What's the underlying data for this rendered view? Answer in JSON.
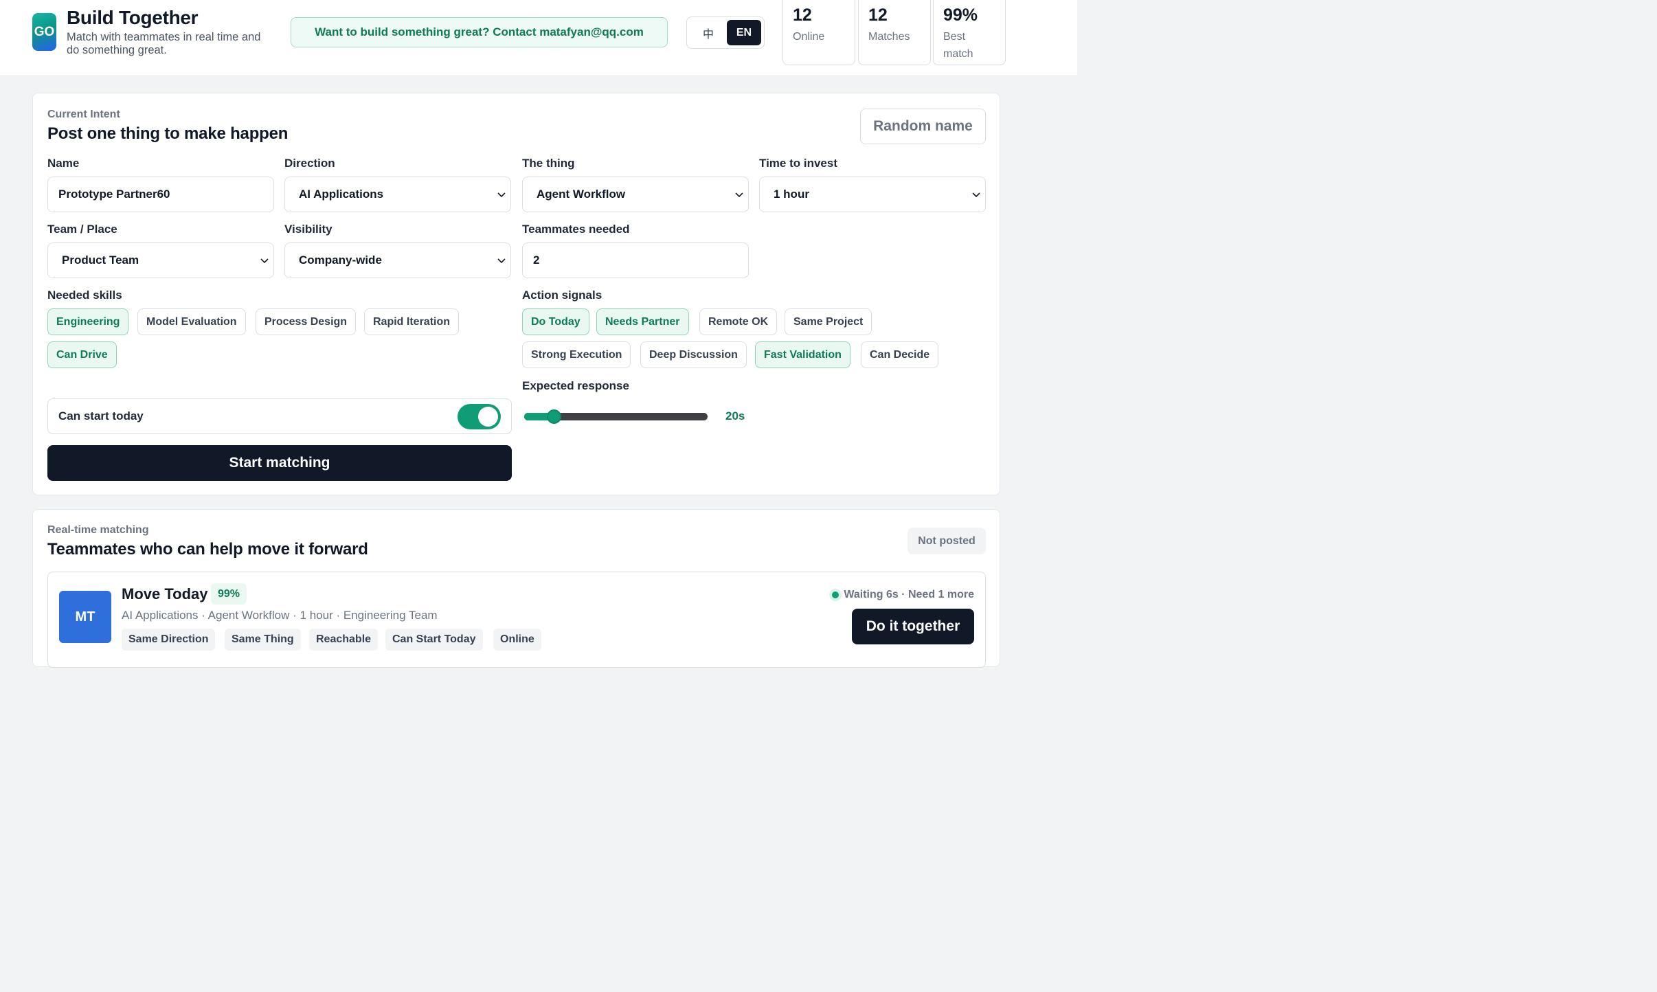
{
  "header": {
    "logo_text": "GO",
    "title": "Build Together",
    "subtitle": "Match with teammates in real time and do something great.",
    "contact": "Want to build something great? Contact matafyan@qq.com",
    "lang_zh": "中",
    "lang_en": "EN",
    "stats": [
      {
        "value": "12",
        "label": "Online"
      },
      {
        "value": "12",
        "label": "Matches"
      },
      {
        "value": "99%",
        "label": "Best match"
      }
    ]
  },
  "intent": {
    "eyebrow": "Current Intent",
    "title": "Post one thing to make happen",
    "random_button": "Random name",
    "name_label": "Name",
    "name_value": "Prototype Partner60",
    "direction_label": "Direction",
    "direction_value": "AI Applications",
    "thing_label": "The thing",
    "thing_value": "Agent Workflow",
    "time_label": "Time to invest",
    "time_value": "1 hour",
    "team_label": "Team / Place",
    "team_value": "Product Team",
    "visibility_label": "Visibility",
    "visibility_value": "Company-wide",
    "teammates_label": "Teammates needed",
    "teammates_value": "2",
    "skills_label": "Needed skills",
    "skills": [
      {
        "label": "Engineering",
        "selected": true
      },
      {
        "label": "Model Evaluation",
        "selected": false
      },
      {
        "label": "Process Design",
        "selected": false
      },
      {
        "label": "Rapid Iteration",
        "selected": false
      },
      {
        "label": "Can Drive",
        "selected": true
      }
    ],
    "signals_label": "Action signals",
    "signals": [
      {
        "label": "Do Today",
        "selected": true
      },
      {
        "label": "Needs Partner",
        "selected": true
      },
      {
        "label": "Remote OK",
        "selected": false
      },
      {
        "label": "Same Project",
        "selected": false
      },
      {
        "label": "Strong Execution",
        "selected": false
      },
      {
        "label": "Deep Discussion",
        "selected": false
      },
      {
        "label": "Fast Validation",
        "selected": true
      },
      {
        "label": "Can Decide",
        "selected": false
      }
    ],
    "toggle_label": "Can start today",
    "toggle_on": true,
    "response_label": "Expected response",
    "response_value": "20s",
    "response_fraction": 0.16,
    "start_button": "Start matching"
  },
  "matching": {
    "eyebrow": "Real-time matching",
    "title": "Teammates who can help move it forward",
    "status": "Not posted",
    "match": {
      "initials": "MT",
      "name": "Move Today",
      "score": "99%",
      "meta": "AI Applications · Agent Workflow · 1 hour · Engineering Team",
      "tags": [
        "Same Direction",
        "Same Thing",
        "Reachable",
        "Can Start Today",
        "Online"
      ],
      "waiting": "Waiting 6s · Need 1 more",
      "button": "Do it together"
    }
  },
  "colors": {
    "accent": "#0f9d76",
    "accent_text": "#0f7a5a",
    "dark": "#111827",
    "avatar": "#2f6fdb"
  }
}
